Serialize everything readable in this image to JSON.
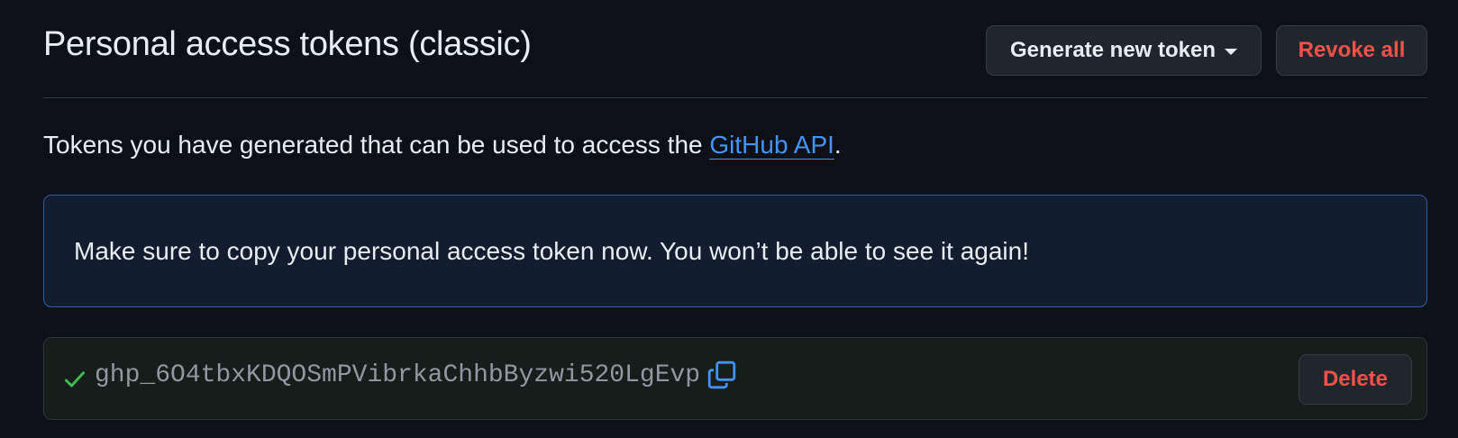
{
  "header": {
    "title": "Personal access tokens (classic)",
    "generate_label": "Generate new token",
    "revoke_label": "Revoke all"
  },
  "intro": {
    "text": "Tokens you have generated that can be used to access the ",
    "link_text": "GitHub API",
    "suffix": "."
  },
  "flash": {
    "message": "Make sure to copy your personal access token now. You won’t be able to see it again!"
  },
  "token": {
    "value": "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",
    "delete_label": "Delete",
    "status_icon": "check-icon",
    "copy_icon": "copy-icon"
  },
  "colors": {
    "background": "#0d1117",
    "danger": "#f85149",
    "link": "#4493f8",
    "success": "#3fb950",
    "flash_border": "#2f5fa1"
  }
}
